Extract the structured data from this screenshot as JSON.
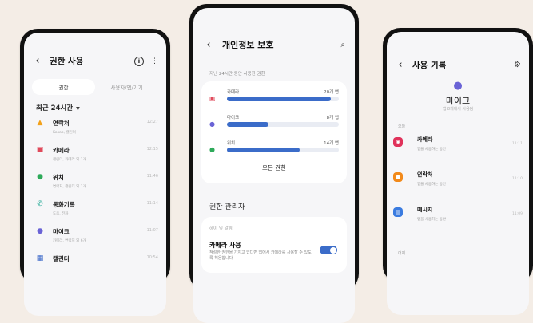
{
  "phone_left": {
    "title": "권한 사용",
    "info_glyph": "i",
    "more_glyph": "⋮",
    "tabs": [
      "권한",
      "사용자/앱/기기"
    ],
    "period": "최근 24시간",
    "apps": [
      {
        "name": "연락처",
        "sub": "Kakao, 캘린더",
        "time": "12:27",
        "icon": "person-icon",
        "color": "#f2a11b",
        "glyph": "▲"
      },
      {
        "name": "카메라",
        "sub": "캘린더, 카메라 외 1개",
        "time": "12:15",
        "icon": "camera-icon",
        "color": "#e04a5b",
        "glyph": "▣"
      },
      {
        "name": "위치",
        "sub": "연락처, 캘린더 외 1개",
        "time": "11:46",
        "icon": "location-icon",
        "color": "#2eaa5a",
        "glyph": "●"
      },
      {
        "name": "통화기록",
        "sub": "도움, 전화",
        "time": "11:14",
        "icon": "call-log-icon",
        "color": "#2fae9b",
        "glyph": "✆"
      },
      {
        "name": "마이크",
        "sub": "카메라, 연락처 외 6개",
        "time": "11:07",
        "icon": "microphone-icon",
        "color": "#6a63d6",
        "glyph": "●"
      },
      {
        "name": "캘린더",
        "sub": "",
        "time": "10:54",
        "icon": "calendar-icon",
        "color": "#3a67c8",
        "glyph": "▦"
      }
    ]
  },
  "phone_center": {
    "title": "개인정보 보호",
    "caption": "지난 24시간 동안 사용한 권한",
    "bars": [
      {
        "label": "카메라",
        "count": "20개 앱",
        "fill": 0.93,
        "icon": "camera-icon",
        "color": "#e04a5b",
        "glyph": "▣"
      },
      {
        "label": "마이크",
        "count": "8개 앱",
        "fill": 0.37,
        "icon": "microphone-icon",
        "color": "#6a63d6",
        "glyph": "●"
      },
      {
        "label": "위치",
        "count": "14개 앱",
        "fill": 0.65,
        "icon": "location-icon",
        "color": "#2eaa5a",
        "glyph": "●"
      }
    ],
    "all_permissions": "모든 권한",
    "section_title": "권한 관리자",
    "sub_header": "하이 및 알림",
    "setting_title": "카메라 사용",
    "setting_desc": "적절한 권한을 가지고 있다면 앱에서 카메라를 사용할 수 있도록 허용합니다",
    "toggle_on": true,
    "accent": "#3b6cc9"
  },
  "phone_right": {
    "title": "사용 기록",
    "permission": "마이크",
    "sub": "앱 8개에서 사용됨",
    "day_today": "오늘",
    "day_yesterday": "어제",
    "rows": [
      {
        "name": "카메라",
        "sub": "앱을 사용하는 동안",
        "time": "11:11",
        "icon": "camera-app-icon",
        "color": "#e0325b",
        "glyph": "◉"
      },
      {
        "name": "연락처",
        "sub": "앱을 사용하는 동안",
        "time": "11:10",
        "icon": "contacts-app-icon",
        "color": "#f28a1b",
        "glyph": "●"
      },
      {
        "name": "메시지",
        "sub": "앱을 사용하는 동안",
        "time": "11:09",
        "icon": "messages-app-icon",
        "color": "#3a7be0",
        "glyph": "▤"
      }
    ]
  }
}
